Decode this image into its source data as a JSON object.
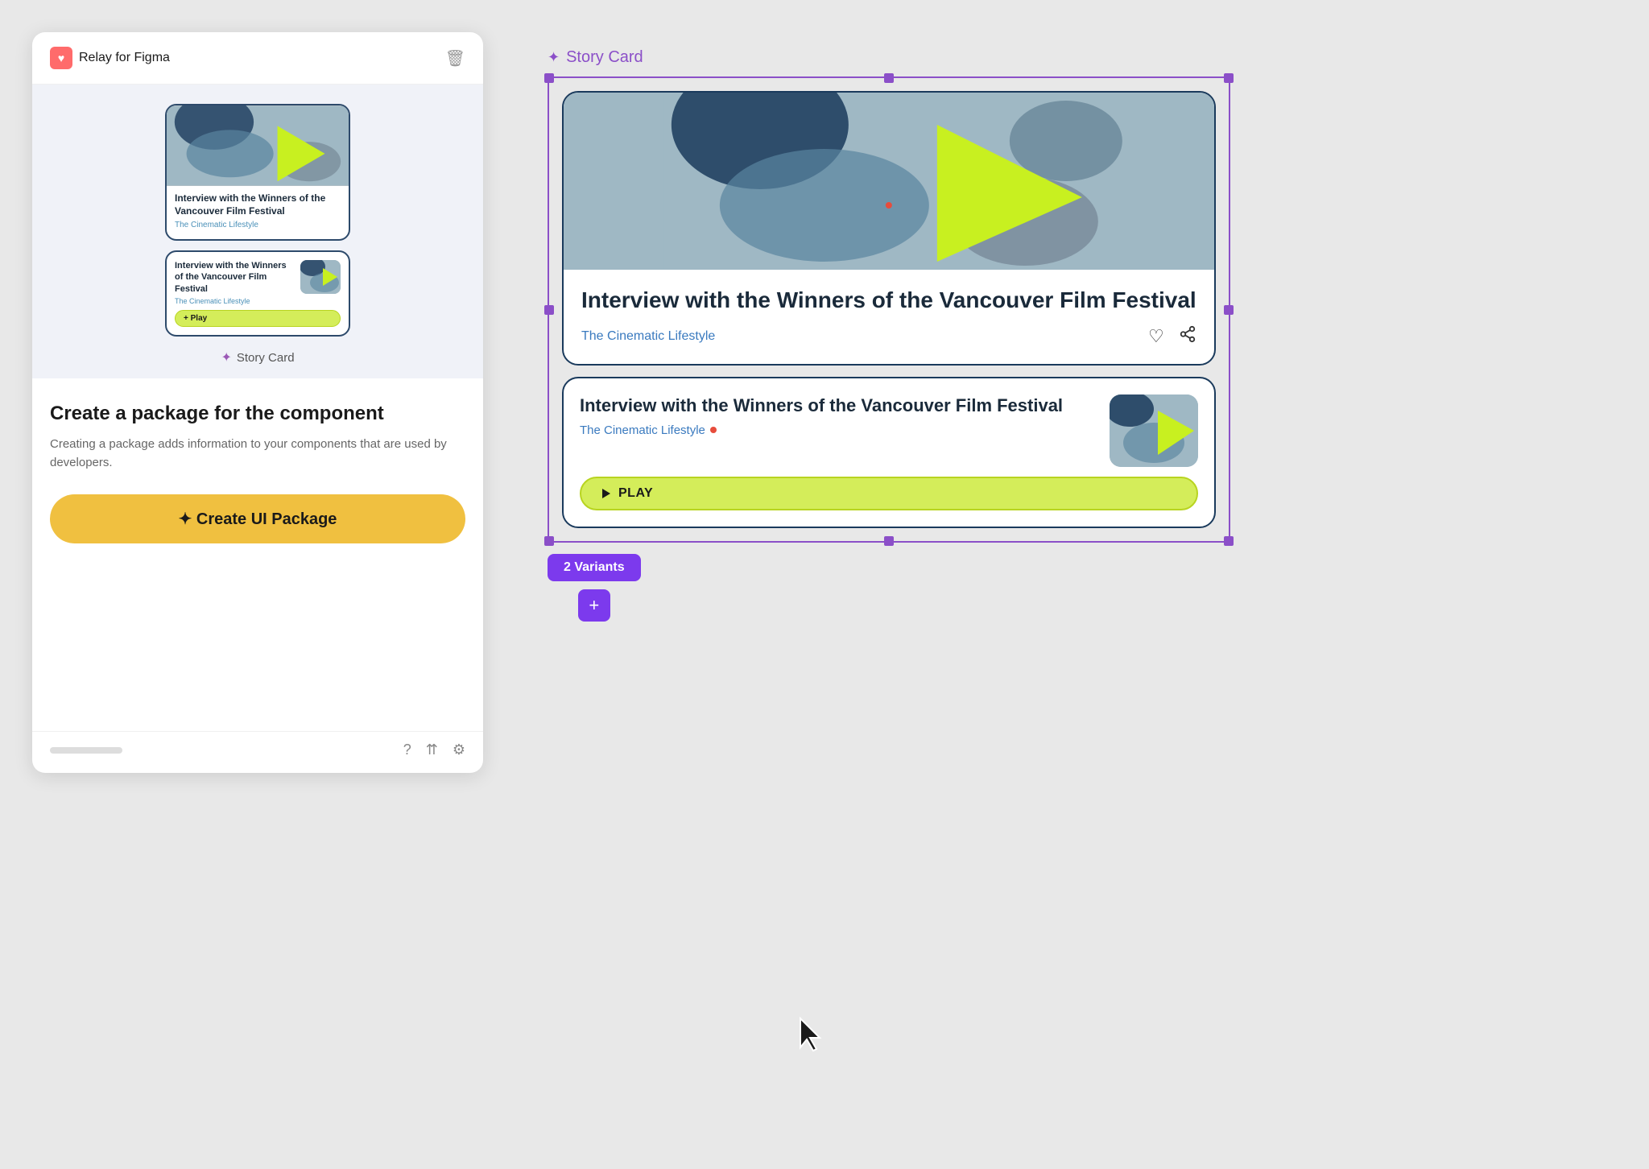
{
  "app": {
    "name": "Relay for Figma"
  },
  "left_panel": {
    "header": {
      "title": "Relay for Figma"
    },
    "card_large": {
      "title": "Interview with the Winners of the Vancouver Film Festival",
      "subtitle": "The Cinematic Lifestyle"
    },
    "card_horiz": {
      "title": "Interview with the Winners of the Vancouver Film Festival",
      "subtitle": "The Cinematic Lifestyle",
      "play_label": "+ Play"
    },
    "component_label": "Story Card",
    "create_heading": "Create a package for the component",
    "create_desc": "Creating a package adds information to your components that are used by developers.",
    "create_btn_label": "✦ Create UI Package"
  },
  "right": {
    "label": "Story Card",
    "card1": {
      "title": "Interview with the Winners of the Vancouver Film Festival",
      "subtitle": "The Cinematic Lifestyle"
    },
    "card2": {
      "title": "Interview with the Winners of the Vancouver Film Festival",
      "subtitle": "The Cinematic Lifestyle",
      "play_label": "PLAY"
    },
    "variants_label": "2 Variants",
    "add_label": "+"
  },
  "icons": {
    "diamond": "✦",
    "heart": "♡",
    "share": "⎋",
    "help": "?",
    "settings": "⚙",
    "play": "▶",
    "trash": "🗑"
  }
}
